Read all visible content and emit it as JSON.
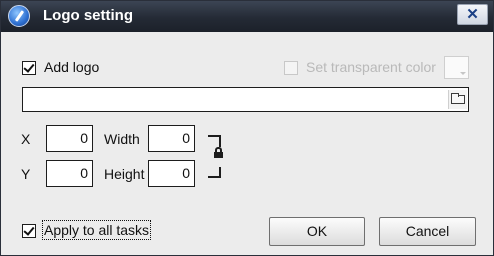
{
  "window": {
    "title": "Logo setting",
    "close_label": "✕"
  },
  "logo": {
    "add_logo_label": "Add logo",
    "add_logo_checked": true,
    "transparent_label": "Set transparent color",
    "transparent_checked": false,
    "path_value": ""
  },
  "position": {
    "x_label": "X",
    "y_label": "Y",
    "width_label": "Width",
    "height_label": "Height",
    "x_value": "0",
    "y_value": "0",
    "width_value": "0",
    "height_value": "0"
  },
  "footer": {
    "apply_label": "Apply to all tasks",
    "apply_checked": true,
    "ok_label": "OK",
    "cancel_label": "Cancel"
  },
  "icons": [
    "app-icon",
    "close-icon",
    "folder-icon",
    "lock-icon"
  ]
}
